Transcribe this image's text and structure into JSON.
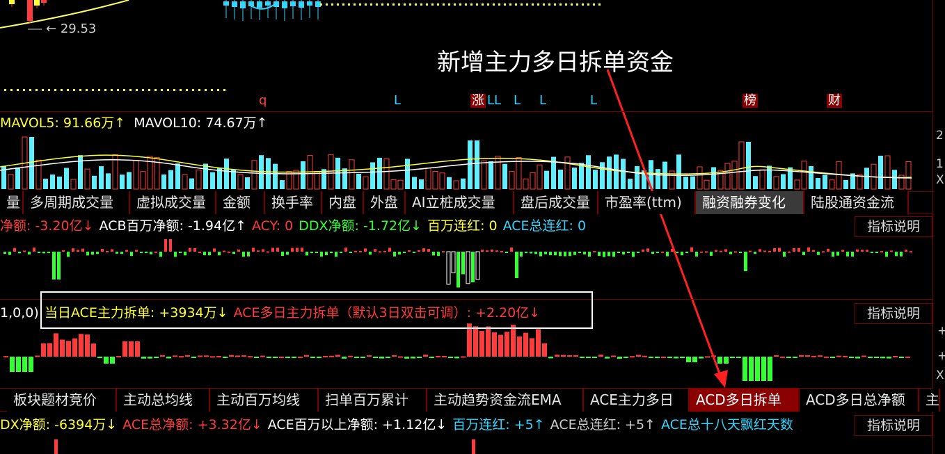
{
  "annotation": "新增主力多日拆单资金",
  "price_label": "29.53",
  "markers": [
    {
      "text": "q",
      "color": "#ff3b3b",
      "boxed": false
    },
    {
      "text": "L",
      "color": "#33d6ff",
      "boxed": false
    },
    {
      "text": "涨",
      "color": "#ffffff",
      "boxed": true
    },
    {
      "text": "LL",
      "color": "#33d6ff",
      "boxed": false
    },
    {
      "text": "L",
      "color": "#33d6ff",
      "boxed": false
    },
    {
      "text": "L",
      "color": "#33d6ff",
      "boxed": false
    },
    {
      "text": "L",
      "color": "#33d6ff",
      "boxed": false
    },
    {
      "text": "榜",
      "color": "#ffffff",
      "boxed": true
    },
    {
      "text": "财",
      "color": "#ffffff",
      "boxed": true
    }
  ],
  "volume": {
    "header": [
      {
        "text": "MAVOL5: 91.66万↑",
        "color": "#ffff33"
      },
      {
        "text": "MAVOL10: 74.67万↑",
        "color": "#ffffff"
      }
    ],
    "axis_labels": [
      "2",
      "1",
      "X"
    ]
  },
  "tabs1": [
    {
      "label": "量",
      "active": false
    },
    {
      "label": "多周期成交量",
      "active": false
    },
    {
      "label": "虚拟成交量",
      "active": false
    },
    {
      "label": "金额",
      "active": false
    },
    {
      "label": "换手率",
      "active": false
    },
    {
      "label": "内盘",
      "active": false
    },
    {
      "label": "外盘",
      "active": false
    },
    {
      "label": "AI立桩成交量",
      "active": false
    },
    {
      "label": "盘后成交量",
      "active": false
    },
    {
      "label": "市盈率(ttm)",
      "active": false
    },
    {
      "label": "融资融券变化",
      "active": true
    },
    {
      "label": "陆股通资金流",
      "active": false
    }
  ],
  "panel1": {
    "header": [
      {
        "text": "净额: -3.20亿↓",
        "color": "#ff3b3b"
      },
      {
        "text": "ACB百万净额: -1.94亿↑",
        "color": "#ffffff"
      },
      {
        "text": "ACY: 0",
        "color": "#ff3b3b"
      },
      {
        "text": "DDX净额: -1.72亿↓",
        "color": "#33ff33"
      },
      {
        "text": "百万连红: 0",
        "color": "#ffff33"
      },
      {
        "text": "ACE总连红: 0",
        "color": "#33d6ff"
      }
    ],
    "explain": "指标说明"
  },
  "panel2": {
    "prefix": "1,0,0)",
    "header": [
      {
        "text": "当日ACE主力拆单: +3934万↓",
        "color": "#ffff33"
      },
      {
        "text": "ACE多日主力拆单（默认3日双击可调）: +2.20亿↓",
        "color": "#ff3b3b"
      }
    ],
    "explain": "指标说明",
    "axis_labels": [
      "+",
      "+",
      "X"
    ]
  },
  "tabs2": [
    {
      "label": "板块题材竞价",
      "active": false
    },
    {
      "label": "主动总均线",
      "active": false
    },
    {
      "label": "主动百万均线",
      "active": false
    },
    {
      "label": "扫单百万累计",
      "active": false
    },
    {
      "label": "主动趋势资金流EMA",
      "active": false
    },
    {
      "label": "ACE主力多日",
      "active": false
    },
    {
      "label": "ACD多日拆单",
      "active": true
    },
    {
      "label": "ACD多日总净额",
      "active": false
    },
    {
      "label": "主",
      "active": false
    }
  ],
  "panel3": {
    "header": [
      {
        "text": "DX净额: -6394万↓",
        "color": "#ffff33"
      },
      {
        "text": "ACE总净额: +3.32亿↓",
        "color": "#ff3b3b"
      },
      {
        "text": "ACE百万以上净额: +1.12亿↓",
        "color": "#ffffff"
      },
      {
        "text": "百万连红: +5↑",
        "color": "#33d6ff"
      },
      {
        "text": "ACE总连红: +5↑",
        "color": "#cccccc"
      },
      {
        "text": "ACE总十八天飘红天数",
        "color": "#33d6ff"
      }
    ],
    "explain": "指标说明"
  }
}
